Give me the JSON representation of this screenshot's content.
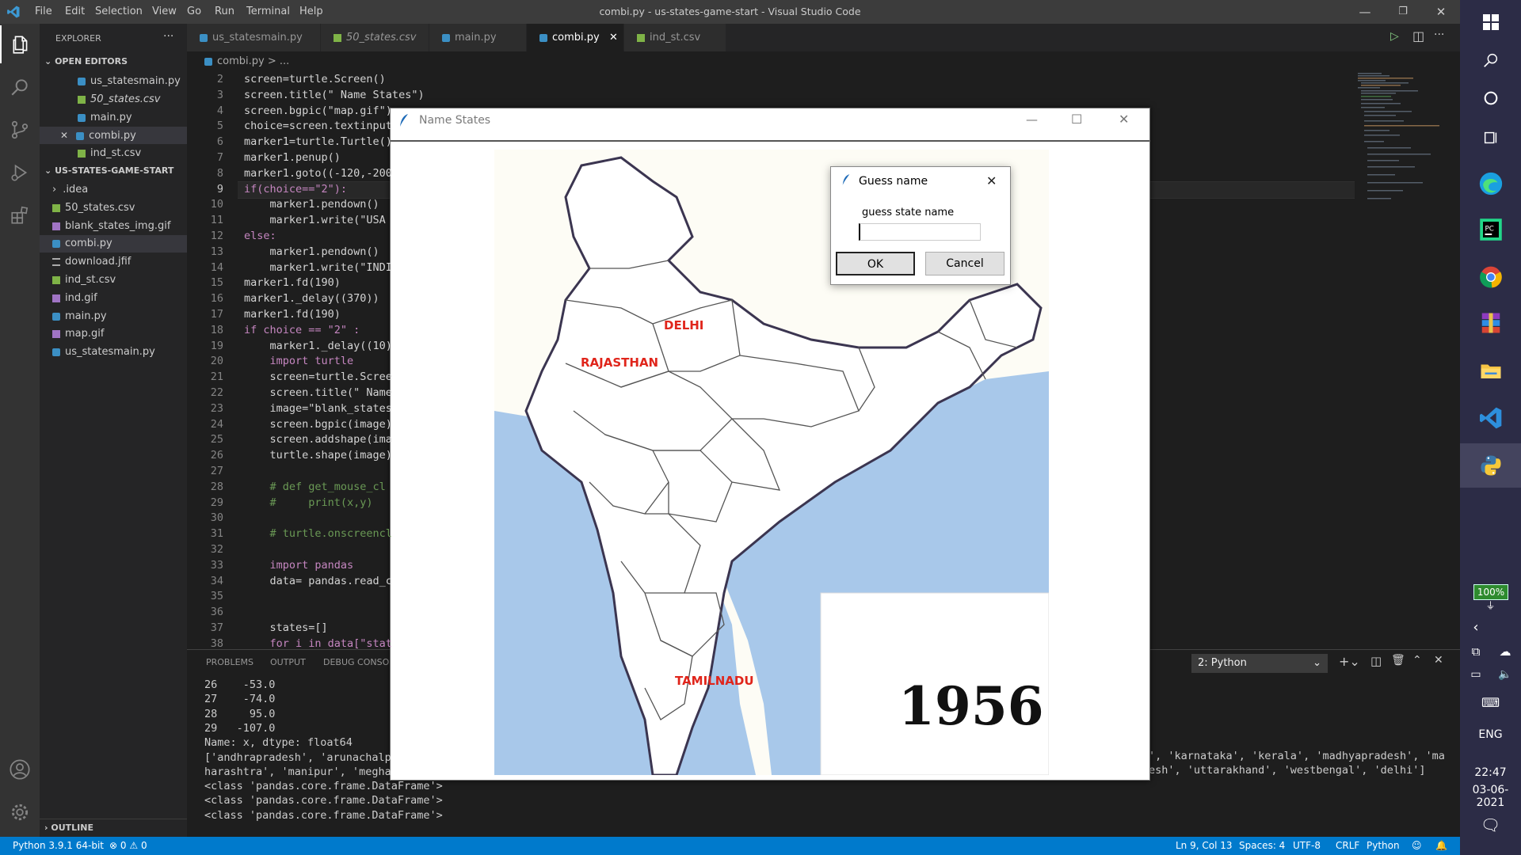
{
  "window": {
    "title": "combi.py - us-states-game-start - Visual Studio Code",
    "menu": [
      "File",
      "Edit",
      "Selection",
      "View",
      "Go",
      "Run",
      "Terminal",
      "Help"
    ]
  },
  "sidebar": {
    "header": "EXPLORER",
    "open_editors_label": "OPEN EDITORS",
    "open_editors": [
      "us_statesmain.py",
      "50_states.csv",
      "main.py",
      "combi.py",
      "ind_st.csv"
    ],
    "project_label": "US-STATES-GAME-START",
    "files": [
      ".idea",
      "50_states.csv",
      "blank_states_img.gif",
      "combi.py",
      "download.jfif",
      "ind_st.csv",
      "ind.gif",
      "main.py",
      "map.gif",
      "us_statesmain.py"
    ],
    "outline_label": "OUTLINE"
  },
  "tabs": [
    "us_statesmain.py",
    "50_states.csv",
    "main.py",
    "combi.py",
    "ind_st.csv"
  ],
  "breadcrumb": "combi.py > ...",
  "code": {
    "line_numbers": [
      "2",
      "3",
      "4",
      "5",
      "6",
      "7",
      "8",
      "9",
      "10",
      "11",
      "12",
      "13",
      "14",
      "15",
      "16",
      "17",
      "18",
      "19",
      "20",
      "21",
      "22",
      "23",
      "24",
      "25",
      "26",
      "27",
      "28",
      "29",
      "30",
      "31",
      "32",
      "33",
      "34",
      "35",
      "36",
      "37",
      "38"
    ],
    "lines": [
      "screen=turtle.Screen()",
      "screen.title(\" Name States\")",
      "screen.bgpic(\"map.gif\")",
      "choice=screen.textinput",
      "marker1=turtle.Turtle()",
      "marker1.penup()",
      "marker1.goto((-120,-200",
      "if(choice==\"2\"):",
      "    marker1.pendown()",
      "    marker1.write(\"USA",
      "else:",
      "    marker1.pendown()",
      "    marker1.write(\"INDI",
      "marker1.fd(190)",
      "marker1._delay((370))",
      "marker1.fd(190)",
      "if choice == \"2\" :",
      "    marker1._delay((10)",
      "    import turtle",
      "    screen=turtle.Scree",
      "    screen.title(\" Name",
      "    image=\"blank_states",
      "    screen.bgpic(image)",
      "    screen.addshape(ima",
      "    turtle.shape(image)",
      "",
      "    # def get_mouse_cl",
      "    #     print(x,y)",
      "",
      "    # turtle.onscreencl",
      "",
      "    import pandas",
      "    data= pandas.read_c",
      "",
      "",
      "    states=[]",
      "    for i in data[\"stat"
    ]
  },
  "panel": {
    "tabs": [
      "PROBLEMS",
      "OUTPUT",
      "DEBUG CONSOL"
    ],
    "terminal_select": "2: Python",
    "left_lines": [
      "26    -53.0",
      "27    -74.0",
      "28     95.0",
      "29   -107.0",
      "Name: x, dtype: float64",
      "['andhrapradesh', 'arunachalp",
      "harashtra', 'manipur', 'megha",
      "<class 'pandas.core.frame.DataFrame'>",
      "<class 'pandas.core.frame.DataFrame'>",
      "<class 'pandas.core.frame.DataFrame'>"
    ],
    "right_lines": [
      "', 'karnataka', 'kerala', 'madhyapradesh', 'ma",
      "esh', 'uttarakhand', 'westbengal', 'delhi']"
    ]
  },
  "turtle_window": {
    "title": "Name States",
    "labels": [
      "DELHI",
      "RAJASTHAN",
      "TAMILNADU"
    ],
    "year": "1956"
  },
  "dialog": {
    "title": "Guess name",
    "prompt": "guess state name",
    "input_value": "",
    "ok": "OK",
    "cancel": "Cancel"
  },
  "status": {
    "python": "Python 3.9.1 64-bit",
    "errors": "0",
    "warnings": "0",
    "position": "Ln 9, Col 13",
    "spaces": "Spaces: 4",
    "encoding": "UTF-8",
    "eol": "CRLF",
    "language": "Python"
  },
  "taskbar": {
    "battery": "100%",
    "lang": "ENG",
    "time": "22:47",
    "date": "03-06-2021"
  }
}
